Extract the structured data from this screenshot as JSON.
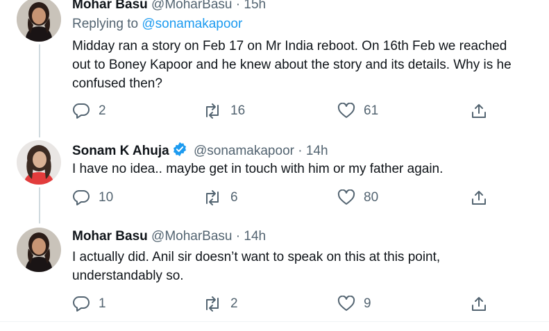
{
  "tweets": [
    {
      "name": "Mohar Basu",
      "handle": "@MoharBasu",
      "time": "15h",
      "replying_label": "Replying to",
      "replying_to": "@sonamakapoor",
      "text_lines": [
        "Midday ran a story on Feb 17 on Mr India reboot. On 16th Feb we reached",
        "out to Boney Kapoor and he knew about the story and its details. Why is he",
        "confused then?"
      ],
      "replies": "2",
      "retweets": "16",
      "likes": "61"
    },
    {
      "name": "Sonam K Ahuja",
      "handle": "@sonamakapoor",
      "time": "14h",
      "verified": true,
      "text_lines": [
        "I have no idea.. maybe get in touch with him or my father again."
      ],
      "replies": "10",
      "retweets": "6",
      "likes": "80"
    },
    {
      "name": "Mohar Basu",
      "handle": "@MoharBasu",
      "time": "14h",
      "text_lines": [
        "I actually did. Anil sir doesn’t want to speak on this at this point,",
        "understandably so."
      ],
      "replies": "1",
      "retweets": "2",
      "likes": "9"
    }
  ],
  "separator": "·",
  "colors": {
    "accent": "#1d9bf0",
    "secondary_text": "#536471",
    "text": "#0f1419"
  },
  "icons": {
    "reply": "reply-icon",
    "retweet": "retweet-icon",
    "like": "like-icon",
    "share": "share-icon",
    "verified": "verified-badge-icon"
  }
}
